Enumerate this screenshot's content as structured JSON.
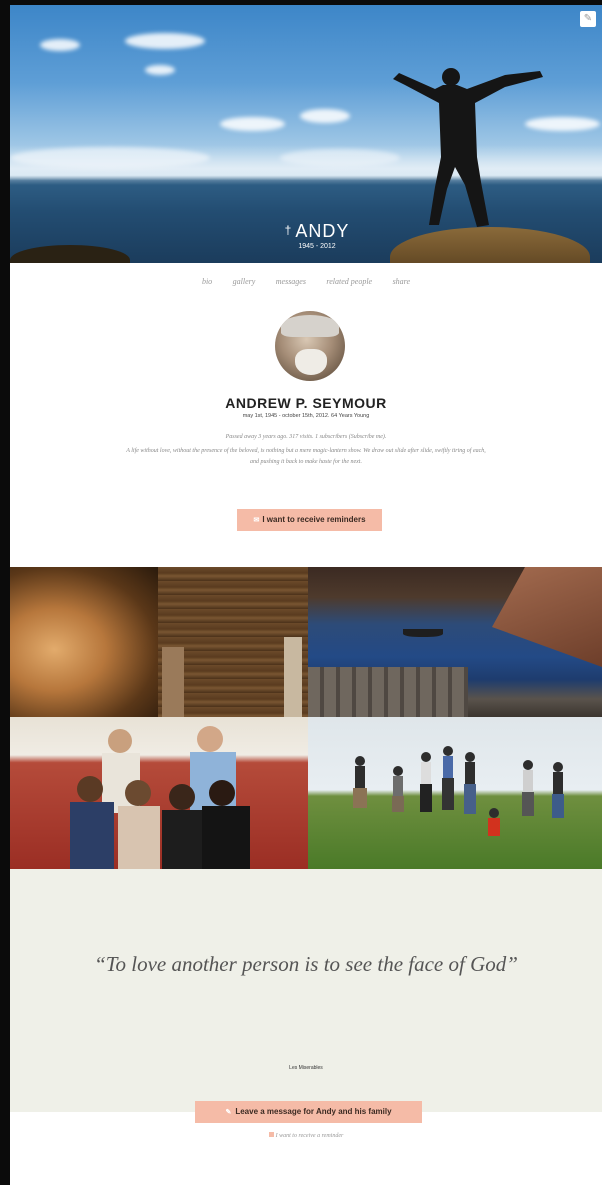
{
  "hero": {
    "name": "ANDY",
    "years": "1945 - 2012",
    "cross": "†",
    "edit_icon": "✎"
  },
  "nav": {
    "items": [
      "bio",
      "gallery",
      "messages",
      "related people",
      "share"
    ]
  },
  "profile": {
    "full_name": "ANDREW P. SEYMOUR",
    "dates": "may 1st, 1945 - october 15th, 2012. 64 Years Young",
    "stats": "Passed away 3 years ago. 317 visits. 1 subscribers (Subscribe me).",
    "bio": "A life without love, without the presence of the beloved, is nothing but a mere magic-lantern show. We draw out slide after slide, swiftly tiring of each, and pushing it back to make haste for the next."
  },
  "reminder_button": {
    "label": "I want to receive reminders",
    "icon": "✉"
  },
  "gallery": {
    "photos": [
      "face-closeup",
      "wooden-ceiling",
      "river-boat",
      "family-group",
      "jumping-friends"
    ]
  },
  "quote": {
    "text": "“To love another person is to see the face of God”",
    "author": "Les Miserables"
  },
  "message_button": {
    "label": "Leave a message for Andy and his family",
    "icon": "✎"
  },
  "reminder_check": {
    "label": "I want to receive a reminder"
  },
  "colors": {
    "accent": "#f5bba7",
    "quote_bg": "#eff0e8",
    "frame": "#0b0b0b"
  }
}
